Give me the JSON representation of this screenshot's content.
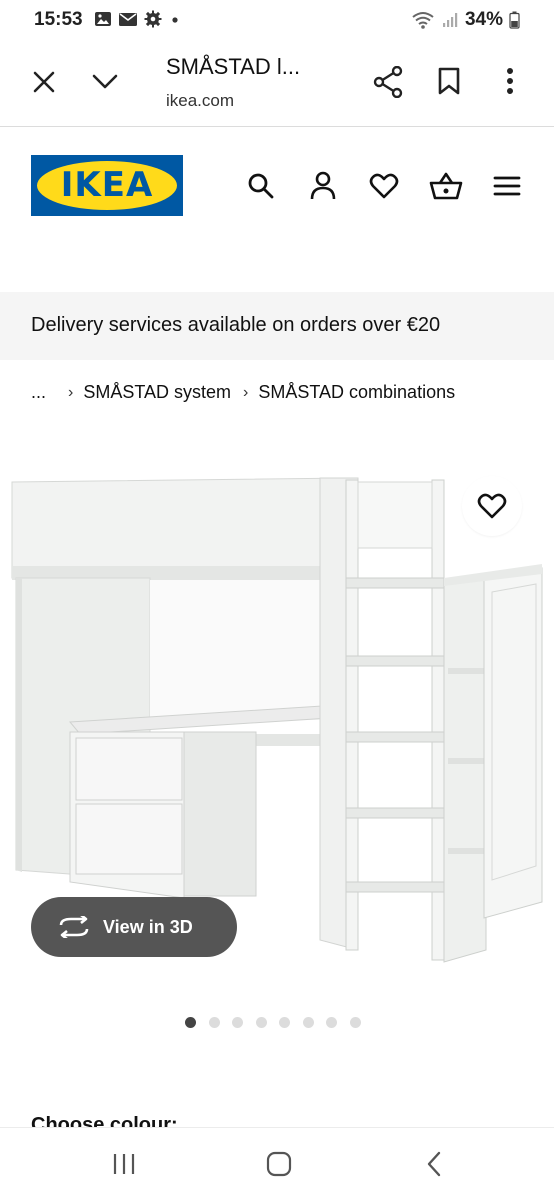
{
  "status_bar": {
    "time": "15:53",
    "battery": "34%",
    "left_icons": [
      "image-icon",
      "mail-icon",
      "gear-icon",
      "dot-icon"
    ],
    "right_icons": [
      "wifi-icon",
      "signal-icon",
      "battery-icon"
    ]
  },
  "browser": {
    "title": "SMÅSTAD l...",
    "url": "ikea.com",
    "icons": [
      "close-icon",
      "chevron-down-icon",
      "share-icon",
      "bookmark-icon",
      "more-vert-icon"
    ]
  },
  "header": {
    "logo_text": "IKEA",
    "icons": [
      "search-icon",
      "account-icon",
      "heart-icon",
      "basket-icon",
      "menu-icon"
    ],
    "brand_blue": "#0058a3",
    "brand_yellow": "#ffda1a"
  },
  "banner": {
    "text": "Delivery services available on orders over €20"
  },
  "breadcrumb": {
    "items": [
      "...",
      "SMÅSTAD system",
      "SMÅSTAD combinations"
    ]
  },
  "product": {
    "view3d_label": "View in 3D",
    "carousel": {
      "total": 8,
      "active_index": 0
    }
  },
  "section": {
    "choose_colour": "Choose colour:"
  },
  "nav": {
    "icons": [
      "recent-apps-icon",
      "home-icon",
      "back-icon"
    ]
  }
}
